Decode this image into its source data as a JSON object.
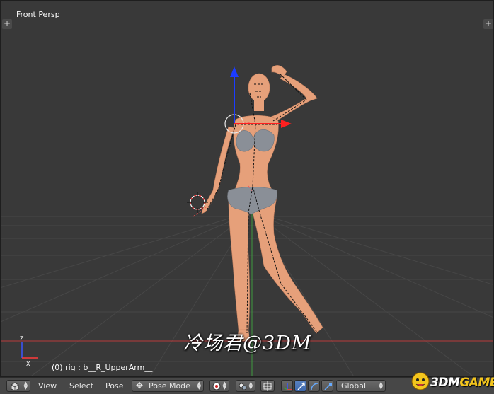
{
  "viewport": {
    "view_label": "Front Persp",
    "selected_info": "(0) rig : b__R_UpperArm__",
    "watermark": "冷场君@3DM",
    "axis_z_label": "Z",
    "axis_x_label": "X"
  },
  "header": {
    "menu_view": "View",
    "menu_select": "Select",
    "menu_pose": "Pose",
    "mode": "Pose Mode",
    "orientation": "Global"
  },
  "logo": {
    "prefix": "3DM",
    "suffix": "GAME"
  },
  "colors": {
    "viewport_bg": "#393939",
    "grid": "#4a4a4a",
    "axis_x_red": "#c43a3a",
    "axis_y_green": "#3f9a3f",
    "gizmo_x": "#ff2020",
    "gizmo_z": "#1c3cff",
    "skin": "#e6a07a",
    "underwear": "#8a8f97",
    "header_bg": "#474747",
    "active_blue": "#4a75b8"
  }
}
